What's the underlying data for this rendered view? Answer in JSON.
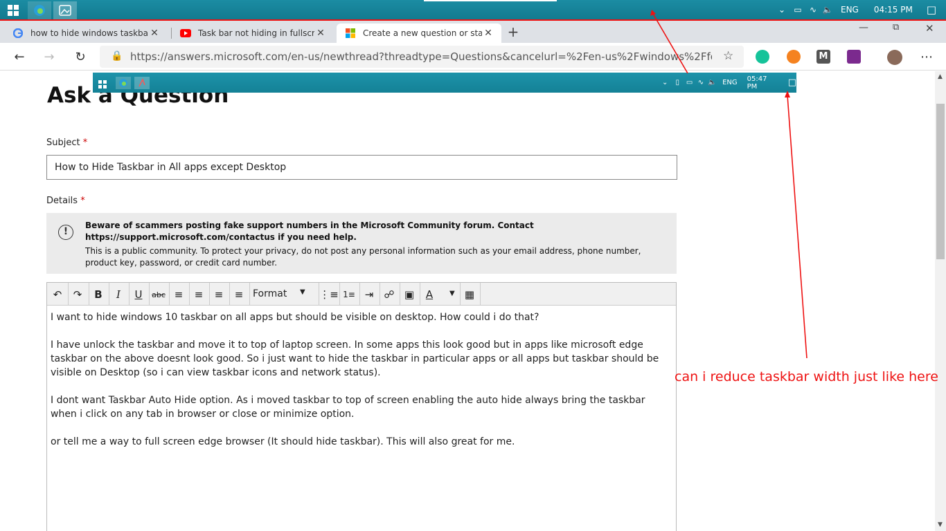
{
  "taskbar": {
    "tray_language": "ENG",
    "tray_time": "04:15 PM"
  },
  "tabs": [
    {
      "title": "how to hide windows taskbar in all apps",
      "favicon": "google-icon"
    },
    {
      "title": "Task bar not hiding in fullscreen mode",
      "favicon": "youtube-icon"
    },
    {
      "title": "Create a new question or start a discussion",
      "favicon": "microsoft-icon"
    }
  ],
  "address": {
    "url": "https://answers.microsoft.com/en-us/newthread?threadtype=Questions&cancelurl=%2Fen-us%2Fwindows%2Fforum..."
  },
  "page": {
    "title": "Ask a Question",
    "subject_label": "Subject",
    "required_mark": "*",
    "subject_value": "How to Hide Taskbar in All apps except Desktop",
    "details_label": "Details",
    "notice_bold": "Beware of scammers posting fake support numbers in the Microsoft Community forum. Contact https://support.microsoft.com/contactus if you need help.",
    "notice_text": "This is a public community. To protect your privacy, do not post any personal information such as your email address, phone number, product key, password, or credit card number.",
    "format_label": "Format",
    "body": [
      "I want to hide windows 10 taskbar on all apps but should be visible on desktop. How could i do that?",
      "I have unlock the taskbar and move it to top of laptop screen. In some apps this look good but in apps like microsoft edge taskbar on the above doesnt look good. So i just want to hide the taskbar in particular apps or all apps but taskbar should be visible on Desktop (so i can view taskbar icons and network status).",
      "I dont want Taskbar Auto Hide option. As i moved taskbar to top of screen enabling the auto hide always bring the taskbar when i click on any tab in browser or close or minimize option.",
      "or tell me a way to full screen edge browser (It should hide taskbar). This will also great for me."
    ]
  },
  "mini_taskbar": {
    "tray_language": "ENG",
    "tray_time": "05:47 PM"
  },
  "annotation": {
    "text": "can i reduce taskbar width just like here",
    "color": "#ee1111"
  }
}
